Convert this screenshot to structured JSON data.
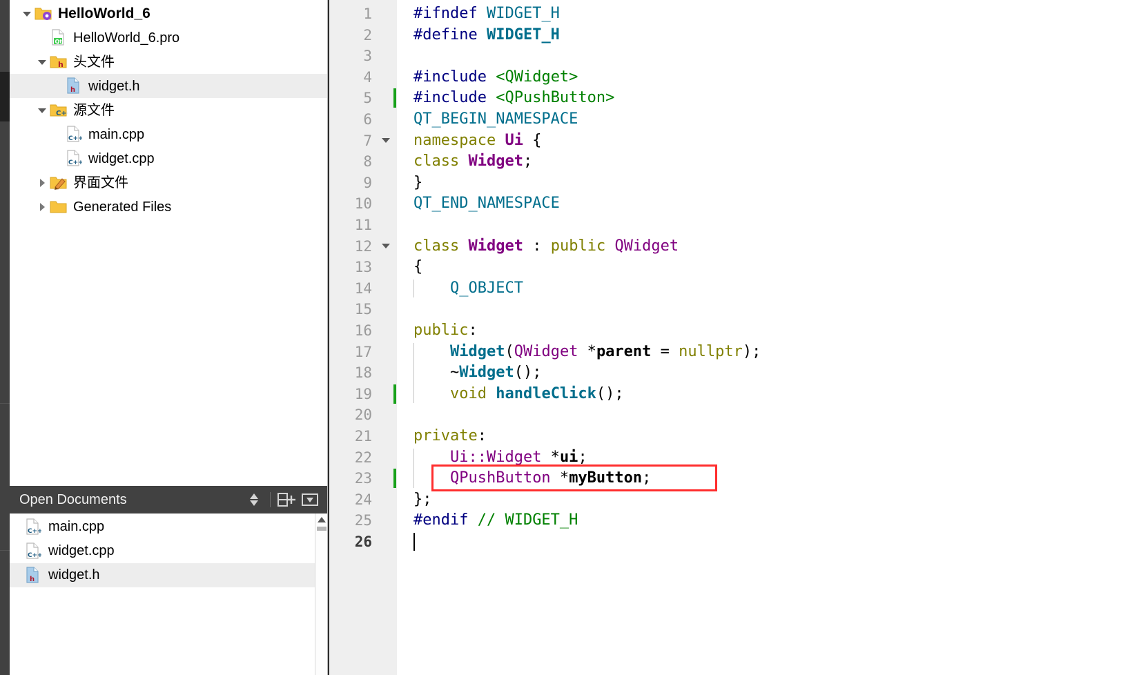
{
  "window": {
    "app": "Qt Creator",
    "accent_red": "#ff2d2d",
    "panel_dark": "#414141",
    "selection_gray": "#ededed"
  },
  "mode_strip": {
    "name": "mode-selector"
  },
  "project_tree": {
    "items": [
      {
        "label": "HelloWorld_6",
        "icon": "project-folder-icon",
        "indent": 0,
        "expander": "down",
        "selected": false,
        "bold": true
      },
      {
        "label": "HelloWorld_6.pro",
        "icon": "qt-pro-file-icon",
        "indent": 1,
        "expander": "none",
        "selected": false,
        "bold": false
      },
      {
        "label": "头文件",
        "icon": "header-folder-icon",
        "indent": 1,
        "expander": "down",
        "selected": false,
        "bold": false
      },
      {
        "label": "widget.h",
        "icon": "h-file-icon",
        "indent": 2,
        "expander": "none",
        "selected": true,
        "bold": false
      },
      {
        "label": "源文件",
        "icon": "source-folder-icon",
        "indent": 1,
        "expander": "down",
        "selected": false,
        "bold": false
      },
      {
        "label": "main.cpp",
        "icon": "cpp-file-icon",
        "indent": 2,
        "expander": "none",
        "selected": false,
        "bold": false
      },
      {
        "label": "widget.cpp",
        "icon": "cpp-file-icon",
        "indent": 2,
        "expander": "none",
        "selected": false,
        "bold": false
      },
      {
        "label": "界面文件",
        "icon": "ui-folder-icon",
        "indent": 1,
        "expander": "right",
        "selected": false,
        "bold": false
      },
      {
        "label": "Generated Files",
        "icon": "folder-icon",
        "indent": 1,
        "expander": "right",
        "selected": false,
        "bold": false
      }
    ]
  },
  "open_documents": {
    "title": "Open Documents",
    "tools": [
      {
        "name": "sort-toggle-icon",
        "glyph": "sort"
      },
      {
        "name": "split-add-icon",
        "glyph": "splitadd"
      },
      {
        "name": "close-dropdown-icon",
        "glyph": "dropdown"
      }
    ],
    "items": [
      {
        "label": "main.cpp",
        "icon": "cpp-file-icon",
        "selected": false
      },
      {
        "label": "widget.cpp",
        "icon": "cpp-file-icon",
        "selected": false
      },
      {
        "label": "widget.h",
        "icon": "h-file-icon",
        "selected": true
      }
    ]
  },
  "editor": {
    "file": "widget.h",
    "total_lines": 26,
    "cursor_line": 26,
    "annotation": {
      "name": "red-highlight-box",
      "target_line": 23,
      "target_text": "QPushButton *myButton;"
    },
    "change_marker_lines": [
      5,
      19,
      23
    ],
    "fold_marker_lines": [
      7,
      12
    ],
    "lines": [
      {
        "n": 1,
        "tokens": [
          {
            "t": "#ifndef ",
            "c": "c-pre"
          },
          {
            "t": "WIDGET_H",
            "c": "c-mac"
          }
        ]
      },
      {
        "n": 2,
        "tokens": [
          {
            "t": "#define ",
            "c": "c-pre"
          },
          {
            "t": "WIDGET_H",
            "c": "c-macb"
          }
        ]
      },
      {
        "n": 3,
        "tokens": []
      },
      {
        "n": 4,
        "tokens": [
          {
            "t": "#include ",
            "c": "c-pre"
          },
          {
            "t": "<QWidget>",
            "c": "c-inc"
          }
        ]
      },
      {
        "n": 5,
        "tokens": [
          {
            "t": "#include ",
            "c": "c-pre"
          },
          {
            "t": "<QPushButton>",
            "c": "c-inc"
          }
        ]
      },
      {
        "n": 6,
        "tokens": [
          {
            "t": "QT_BEGIN_NAMESPACE",
            "c": "c-mac"
          }
        ]
      },
      {
        "n": 7,
        "tokens": [
          {
            "t": "namespace ",
            "c": "c-kw"
          },
          {
            "t": "Ui",
            "c": "c-typeb"
          },
          {
            "t": " {",
            "c": "c-plain"
          }
        ]
      },
      {
        "n": 8,
        "tokens": [
          {
            "t": "class ",
            "c": "c-kw"
          },
          {
            "t": "Widget",
            "c": "c-typeb"
          },
          {
            "t": ";",
            "c": "c-plain"
          }
        ]
      },
      {
        "n": 9,
        "tokens": [
          {
            "t": "}",
            "c": "c-plain"
          }
        ]
      },
      {
        "n": 10,
        "tokens": [
          {
            "t": "QT_END_NAMESPACE",
            "c": "c-mac"
          }
        ]
      },
      {
        "n": 11,
        "tokens": []
      },
      {
        "n": 12,
        "tokens": [
          {
            "t": "class ",
            "c": "c-kw"
          },
          {
            "t": "Widget",
            "c": "c-typeb"
          },
          {
            "t": " : ",
            "c": "c-plain"
          },
          {
            "t": "public ",
            "c": "c-kw"
          },
          {
            "t": "QWidget",
            "c": "c-type"
          }
        ]
      },
      {
        "n": 13,
        "tokens": [
          {
            "t": "{",
            "c": "c-plain"
          }
        ]
      },
      {
        "n": 14,
        "tokens": [
          {
            "t": "    ",
            "c": "c-plain"
          },
          {
            "t": "Q_OBJECT",
            "c": "c-mac"
          }
        ]
      },
      {
        "n": 15,
        "tokens": []
      },
      {
        "n": 16,
        "tokens": [
          {
            "t": "public",
            "c": "c-kw"
          },
          {
            "t": ":",
            "c": "c-plain"
          }
        ]
      },
      {
        "n": 17,
        "tokens": [
          {
            "t": "    ",
            "c": "c-plain"
          },
          {
            "t": "Widget",
            "c": "c-fn"
          },
          {
            "t": "(",
            "c": "c-plain"
          },
          {
            "t": "QWidget",
            "c": "c-type"
          },
          {
            "t": " *",
            "c": "c-plain"
          },
          {
            "t": "parent",
            "c": "c-fld"
          },
          {
            "t": " = ",
            "c": "c-plain"
          },
          {
            "t": "nullptr",
            "c": "c-kw"
          },
          {
            "t": ");",
            "c": "c-plain"
          }
        ]
      },
      {
        "n": 18,
        "tokens": [
          {
            "t": "    ~",
            "c": "c-plain"
          },
          {
            "t": "Widget",
            "c": "c-fn"
          },
          {
            "t": "();",
            "c": "c-plain"
          }
        ]
      },
      {
        "n": 19,
        "tokens": [
          {
            "t": "    ",
            "c": "c-plain"
          },
          {
            "t": "void ",
            "c": "c-kw"
          },
          {
            "t": "handleClick",
            "c": "c-fn"
          },
          {
            "t": "();",
            "c": "c-plain"
          }
        ]
      },
      {
        "n": 20,
        "tokens": []
      },
      {
        "n": 21,
        "tokens": [
          {
            "t": "private",
            "c": "c-kw"
          },
          {
            "t": ":",
            "c": "c-plain"
          }
        ]
      },
      {
        "n": 22,
        "tokens": [
          {
            "t": "    ",
            "c": "c-plain"
          },
          {
            "t": "Ui::Widget",
            "c": "c-type"
          },
          {
            "t": " *",
            "c": "c-plain"
          },
          {
            "t": "ui",
            "c": "c-fld"
          },
          {
            "t": ";",
            "c": "c-plain"
          }
        ]
      },
      {
        "n": 23,
        "tokens": [
          {
            "t": "    ",
            "c": "c-plain"
          },
          {
            "t": "QPushButton",
            "c": "c-type"
          },
          {
            "t": " *",
            "c": "c-plain"
          },
          {
            "t": "myButton",
            "c": "c-fld"
          },
          {
            "t": ";",
            "c": "c-plain"
          }
        ]
      },
      {
        "n": 24,
        "tokens": [
          {
            "t": "};",
            "c": "c-plain"
          }
        ]
      },
      {
        "n": 25,
        "tokens": [
          {
            "t": "#endif ",
            "c": "c-pre"
          },
          {
            "t": "// WIDGET_H",
            "c": "c-cmt"
          }
        ]
      },
      {
        "n": 26,
        "tokens": []
      }
    ]
  }
}
